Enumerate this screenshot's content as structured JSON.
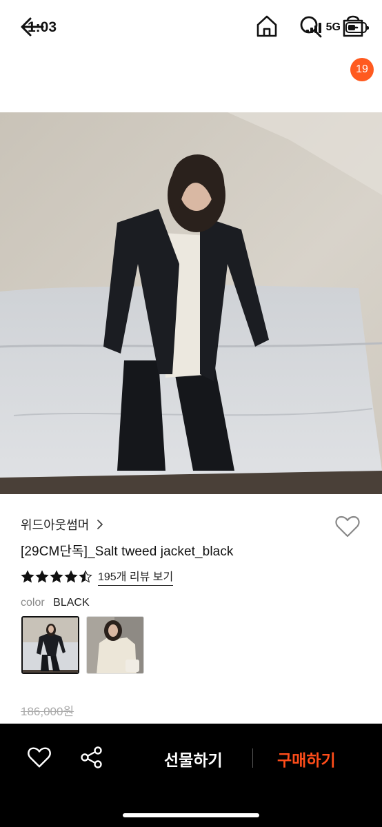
{
  "status": {
    "time": "1:03",
    "network": "5G",
    "battery_level": 0.45
  },
  "nav": {
    "back_icon": "arrow-left-icon",
    "home_icon": "home-icon",
    "search_icon": "search-icon",
    "cart_icon": "shopping-bag-icon",
    "cart_count": "19",
    "badge_color": "#ff5a1f"
  },
  "product": {
    "brand": "위드아웃썸머",
    "name": "[29CM단독]_Salt tweed jacket_black",
    "rating": 4.5,
    "review_link": "195개 리뷰 보기",
    "color_label": "color",
    "color_value": "BLACK",
    "original_price": "186,000원"
  },
  "bottom_bar": {
    "gift_label": "선물하기",
    "buy_label": "구매하기",
    "buy_color": "#ff4d1a"
  }
}
